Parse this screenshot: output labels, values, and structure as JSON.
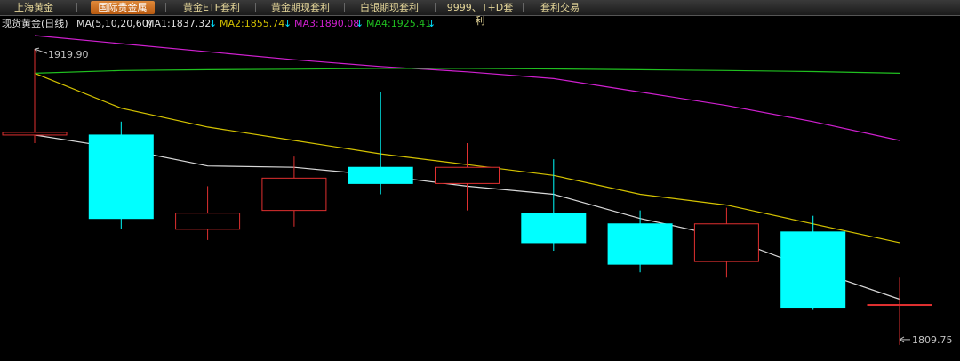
{
  "tabs": [
    {
      "label": "上海黄金",
      "active": false
    },
    {
      "label": "国际贵金属",
      "active": true
    },
    {
      "label": "黄金ETF套利",
      "active": false
    },
    {
      "label": "黄金期现套利",
      "active": false
    },
    {
      "label": "白银期现套利",
      "active": false
    },
    {
      "label": "9999、T+D套利",
      "active": false
    },
    {
      "label": "套利交易",
      "active": false
    }
  ],
  "info": {
    "instrument": "现货黄金(日线)",
    "ma_params": "MA(5,10,20,60)",
    "ma1": "MA1:1837.32",
    "ma2": "MA2:1855.74",
    "ma3": "MA3:1890.08",
    "ma4": "MA4:1925.41",
    "arrow": "↓"
  },
  "colors": {
    "up": "#e03030",
    "down": "#00ffff",
    "ma1": "#d8d8d8",
    "ma2": "#d4c200",
    "ma3": "#d020d0",
    "ma4": "#20c020",
    "label": "#c0c0c0",
    "tab_text": "#e6d79a"
  },
  "chart_data": {
    "type": "candlestick",
    "ylim": [
      1806,
      1925
    ],
    "high_label": "1919.90",
    "low_label": "1809.75",
    "candles": [
      {
        "open": 1888.0,
        "close": 1889.0,
        "high": 1920.0,
        "low": 1885.0
      },
      {
        "open": 1888.0,
        "close": 1857.0,
        "high": 1893.0,
        "low": 1853.0
      },
      {
        "open": 1853.0,
        "close": 1859.0,
        "high": 1869.0,
        "low": 1849.0
      },
      {
        "open": 1860.0,
        "close": 1872.0,
        "high": 1880.0,
        "low": 1854.0
      },
      {
        "open": 1876.0,
        "close": 1870.0,
        "high": 1904.0,
        "low": 1866.0
      },
      {
        "open": 1870.0,
        "close": 1876.0,
        "high": 1885.0,
        "low": 1860.0
      },
      {
        "open": 1859.0,
        "close": 1848.0,
        "high": 1879.0,
        "low": 1845.0
      },
      {
        "open": 1855.0,
        "close": 1840.0,
        "high": 1860.0,
        "low": 1837.0
      },
      {
        "open": 1841.0,
        "close": 1855.0,
        "high": 1861.0,
        "low": 1835.0
      },
      {
        "open": 1852.0,
        "close": 1824.0,
        "high": 1858.0,
        "low": 1823.0
      },
      {
        "open": 1825.0,
        "close": 1825.0,
        "high": 1835.0,
        "low": 1810.0
      }
    ],
    "ma_lines": [
      {
        "name": "MA1",
        "color_key": "ma1",
        "values": [
          1888.0,
          1883.0,
          1876.5,
          1876.0,
          1873.0,
          1869.0,
          1866.0,
          1857.0,
          1850.0,
          1838.0,
          1827.0
        ]
      },
      {
        "name": "MA2",
        "color_key": "ma2",
        "values": [
          1911.0,
          1898.0,
          1891.0,
          1886.0,
          1881.0,
          1877.0,
          1873.0,
          1866.0,
          1862.0,
          1855.0,
          1848.0
        ]
      },
      {
        "name": "MA3",
        "color_key": "ma3",
        "values": [
          1925.0,
          1922.0,
          1919.0,
          1916.0,
          1913.5,
          1911.5,
          1909.0,
          1904.0,
          1899.0,
          1893.0,
          1886.0
        ]
      },
      {
        "name": "MA4",
        "color_key": "ma4",
        "values": [
          1911.0,
          1912.0,
          1912.3,
          1912.5,
          1912.8,
          1912.8,
          1912.6,
          1912.3,
          1912.0,
          1911.6,
          1911.0
        ]
      }
    ]
  }
}
